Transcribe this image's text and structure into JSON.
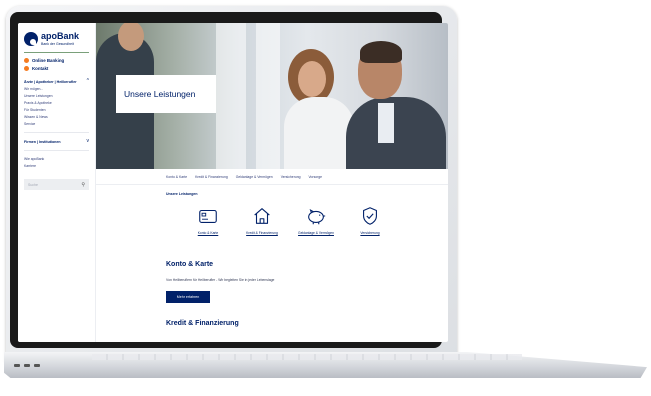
{
  "brand": {
    "name": "apoBank",
    "tagline": "Bank der Gesundheit"
  },
  "sidebar": {
    "links": [
      {
        "label": "Online Banking",
        "icon": "arrow-circle-icon"
      },
      {
        "label": "Kontakt",
        "icon": "arrow-circle-icon"
      }
    ],
    "section1": {
      "label": "Ärzte | Apotheker | Heilberufler",
      "items": [
        "Wir mögen...",
        "Unsere Leistungen",
        "Praxis & Apotheke",
        "Für Studenten",
        "Wissen & News",
        "Service"
      ]
    },
    "section2": {
      "label": "Firmen | Institutionen"
    },
    "extra_items": [
      "Wie apoBank",
      "Karriere"
    ],
    "search_placeholder": "Suche"
  },
  "hero": {
    "title": "Unsere Leistungen"
  },
  "subnav": [
    "Konto & Karte",
    "Kredit & Finanzierung",
    "Geldanlage & Vermögen",
    "Versicherung",
    "Vorsorge"
  ],
  "main": {
    "breadcrumb": "Unsere Leistungen",
    "categories": [
      {
        "label": "Konto & Karte",
        "icon": "card-icon"
      },
      {
        "label": "Kredit & Finanzierung",
        "icon": "house-icon"
      },
      {
        "label": "Geldanlage & Vermögen",
        "icon": "piggy-bank-icon"
      },
      {
        "label": "Versicherung",
        "icon": "shield-check-icon"
      }
    ],
    "section1_title": "Konto & Karte",
    "section1_text": "Von Heilberuflern für Heilberufler - Wir begleiten Sie in jeder Lebenslage",
    "section1_button": "Mehr erfahren",
    "section2_title": "Kredit & Finanzierung"
  },
  "colors": {
    "brand_blue": "#012169",
    "accent_orange": "#f57b20"
  }
}
